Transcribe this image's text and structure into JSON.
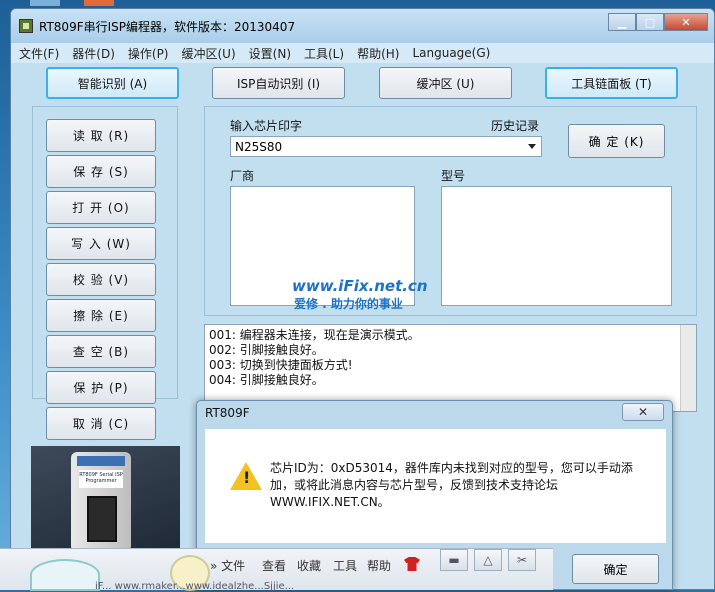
{
  "window": {
    "title": "RT809F串行ISP编程器，软件版本：20130407",
    "minimize": "▁",
    "maximize": "□",
    "close": "✕"
  },
  "menu": [
    "文件(F)",
    "器件(D)",
    "操作(P)",
    "缓冲区(U)",
    "设置(N)",
    "工具(L)",
    "帮助(H)",
    "Language(G)"
  ],
  "top_buttons": [
    {
      "label": "智能识别 (A)",
      "selected": true
    },
    {
      "label": "ISP自动识别 (I)",
      "selected": false
    },
    {
      "label": "缓冲区 (U)",
      "selected": false
    },
    {
      "label": "工具链面板 (T)",
      "selected": true
    }
  ],
  "left_buttons": [
    "读 取 (R)",
    "保 存 (S)",
    "打 开 (O)",
    "写 入 (W)",
    "校 验 (V)",
    "擦 除 (E)",
    "查 空 (B)",
    "保 护 (P)"
  ],
  "cancel_button": "取 消 (C)",
  "device_image": {
    "label": "RT809F Serial ISP Programmer"
  },
  "chip": {
    "input_label": "输入芯片印字",
    "history_label": "历史记录",
    "input_value": "N25S80",
    "confirm_button": "确 定 (K)",
    "vendor_label": "厂商",
    "model_label": "型号"
  },
  "watermark": {
    "url": "www.iFix.net.cn",
    "slogan": "爱修 . 助力你的事业"
  },
  "log": [
    "001: 编程器未连接，现在是演示模式。",
    "002: 引脚接触良好。",
    "003: 切换到快捷面板方式!",
    "004: 引脚接触良好。"
  ],
  "dialog": {
    "title": "RT809F",
    "close": "✕",
    "icon": "warning-icon",
    "message": "芯片ID为：0xD53014，器件库内未找到对应的型号，您可以手动添加，或将此消息内容与芯片型号，反馈到技术支持论坛WWW.IFIX.NET.CN。",
    "ok_button": "确定"
  },
  "bottom_toolbar": {
    "items": [
      "» 文件",
      "查看",
      "收藏",
      "工具",
      "帮助"
    ],
    "url_fragment": "iF... www.rmaker...www.idealzhe...Sjjie..."
  },
  "colors": {
    "window_bg": "#c2dff0",
    "selected_border": "#3bb0e8",
    "watermark": "#1c72c9",
    "warning": "#f3c221"
  }
}
